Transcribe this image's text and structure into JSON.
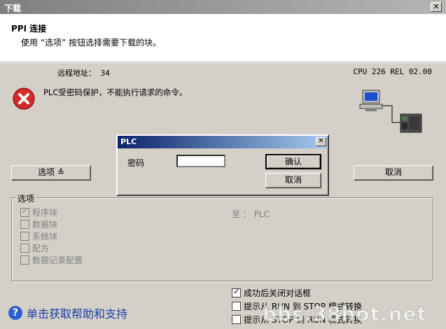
{
  "window": {
    "title": "下载",
    "close_glyph": "✕"
  },
  "header": {
    "title": "PPI 连接",
    "description": "使用 “选项” 按钮选择需要下载的块。"
  },
  "status": {
    "remote_address": "远程地址：  34",
    "cpu_info": "CPU 226 REL 02.00",
    "error_message": "PLC受密码保护，不能执行请求的命令。"
  },
  "buttons": {
    "options": "选项 ≛",
    "cancel": "取消"
  },
  "options_group": {
    "legend": "选项",
    "items": [
      {
        "label": "程序块",
        "checked": true,
        "enabled": false
      },
      {
        "label": "数据块",
        "checked": false,
        "enabled": false
      },
      {
        "label": "系统块",
        "checked": false,
        "enabled": false
      },
      {
        "label": "配方",
        "checked": false,
        "enabled": false
      },
      {
        "label": "数据记录配置",
        "checked": false,
        "enabled": false
      }
    ],
    "to_label": "至 ： PLC"
  },
  "bottom_options": [
    {
      "label": "成功后关闭对话框",
      "checked": true
    },
    {
      "label": "提示从 RUN 到 STOP 模式转换",
      "checked": false
    },
    {
      "label": "提示从 STOP 到 RUN 模式转换",
      "checked": false
    }
  ],
  "help": {
    "icon": "?",
    "label": "单击获取帮助和支持"
  },
  "watermark": "bbs.38hot.net",
  "modal": {
    "title": "PLC",
    "password_label": "密码",
    "password_value": "",
    "ok_label": "确认",
    "cancel_label": "取消",
    "close_glyph": "✕"
  },
  "icons": {
    "error": "error-icon",
    "computer": "computer-plc-icon",
    "help": "help-icon"
  },
  "colors": {
    "dialog_bg": "#d4d0c8",
    "modal_title_start": "#0a246a",
    "modal_title_end": "#a6caf0",
    "error_red": "#d42a2a",
    "help_blue": "#1a3fa8"
  }
}
